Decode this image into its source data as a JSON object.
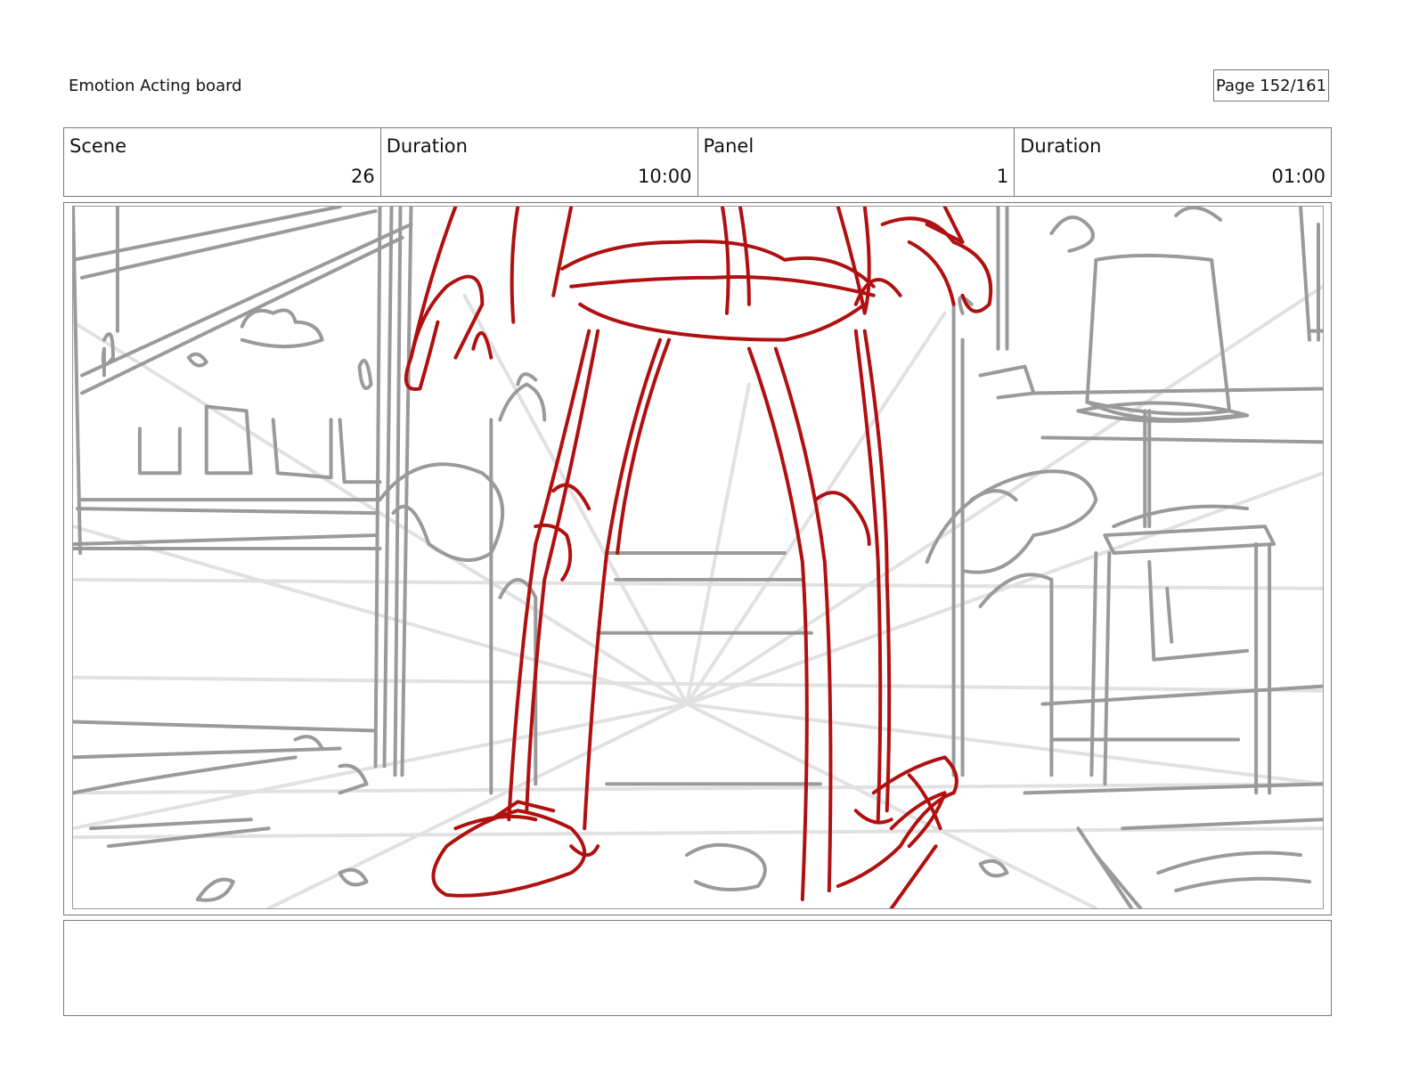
{
  "header": {
    "title": "Emotion Acting board",
    "page": "Page 152/161"
  },
  "info": {
    "scene_label": "Scene",
    "scene_value": "26",
    "scene_duration_label": "Duration",
    "scene_duration_value": "10:00",
    "panel_label": "Panel",
    "panel_value": "1",
    "panel_duration_label": "Duration",
    "panel_duration_value": "01:00"
  },
  "sketch": {
    "background_color": "#9a9a9a",
    "guide_color": "#dedede",
    "character_color": "#b01010"
  },
  "notes": {
    "text": ""
  }
}
